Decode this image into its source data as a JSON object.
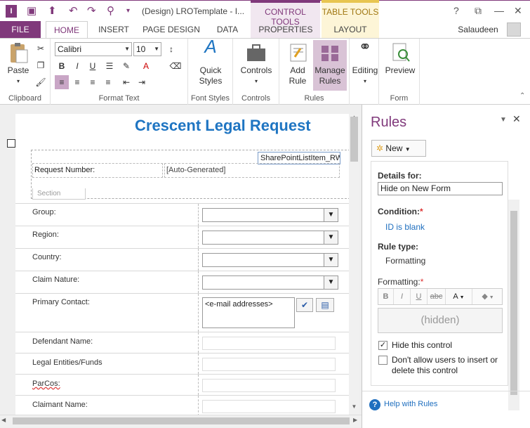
{
  "window": {
    "title": "(Design) LROTemplate - I...",
    "controls": {
      "help": "?",
      "restore": "⧉",
      "minimize": "—",
      "close": "✕"
    }
  },
  "qat": {
    "icons": [
      "infopath-logo-icon",
      "save-icon",
      "publish-icon",
      "undo-icon",
      "redo-icon",
      "preview-icon",
      "qat-customize-icon"
    ]
  },
  "context_tabs": {
    "control_tools": "CONTROL TOOLS",
    "table_tools": "TABLE TOOLS"
  },
  "tabs": {
    "file": "FILE",
    "home": "HOME",
    "insert": "INSERT",
    "page_design": "PAGE DESIGN",
    "data": "DATA",
    "properties": "PROPERTIES",
    "layout": "LAYOUT"
  },
  "user": "Salaudeen",
  "ribbon": {
    "clipboard": {
      "label": "Clipboard",
      "paste": "Paste"
    },
    "format_text": {
      "label": "Format Text",
      "font": "Calibri",
      "size": "10"
    },
    "font_styles": {
      "label": "Font Styles",
      "quick_styles_l1": "Quick",
      "quick_styles_l2": "Styles"
    },
    "controls": {
      "label": "Controls",
      "controls": "Controls"
    },
    "rules": {
      "label": "Rules",
      "add_rule_l1": "Add",
      "add_rule_l2": "Rule",
      "manage_l1": "Manage",
      "manage_l2": "Rules"
    },
    "editing": {
      "editing": "Editing"
    },
    "form": {
      "label": "Form",
      "preview": "Preview"
    }
  },
  "form": {
    "title": "Crescent Legal Request",
    "sharepoint_control": "SharePointListItem_RW",
    "request_number_label": "Request Number:",
    "request_number_value": "[Auto-Generated]",
    "section_label": "Section",
    "fields": [
      {
        "label": "Group:"
      },
      {
        "label": "Region:"
      },
      {
        "label": "Country:"
      },
      {
        "label": "Claim Nature:"
      },
      {
        "label": "Primary Contact:",
        "placeholder": "<e-mail addresses>"
      },
      {
        "label": "Defendant Name:"
      },
      {
        "label": "Legal Entities/Funds"
      },
      {
        "label": "ParCos:"
      },
      {
        "label": "Claimant Name:"
      }
    ]
  },
  "rules_pane": {
    "title": "Rules",
    "new_button": "New",
    "details_for_label": "Details for:",
    "details_for_value": "Hide on New Form",
    "condition_label": "Condition:",
    "condition_value": "ID is blank",
    "rule_type_label": "Rule type:",
    "rule_type_value": "Formatting",
    "formatting_label": "Formatting:",
    "format_buttons": [
      "B",
      "I",
      "U",
      "abc"
    ],
    "preview_text": "(hidden)",
    "hide_control": "Hide this control",
    "hide_checked": true,
    "dont_allow_l1": "Don't allow users to insert or",
    "dont_allow_l2": "delete this control",
    "dont_allow_checked": false,
    "help_link": "Help with Rules",
    "required_mark": "*"
  },
  "colors": {
    "accent": "#80397b",
    "title_blue": "#1f75c2",
    "link_blue": "#1f6fbf"
  }
}
